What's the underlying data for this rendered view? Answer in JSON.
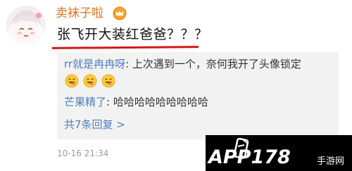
{
  "comment": {
    "username": "卖袜子啦",
    "text": "张飞开大装红爸爸？？？",
    "timestamp": "10-16 21:34"
  },
  "replies": [
    {
      "user": "rr就是冉冉呀",
      "separator": ": ",
      "text": "上次遇到一个，奈何我开了头像锁定",
      "emoji_count": 3
    },
    {
      "user": "芒果精了",
      "separator": ": ",
      "text": "哈哈哈哈哈哈哈哈哈"
    }
  ],
  "more_replies_label": "共7条回复 >",
  "icons": {
    "vip": "crown-badge-icon",
    "emoji": "grinning-tongue-emoji-icon"
  },
  "watermark": {
    "logo_text": "APP178",
    "sub_text": "手游网"
  },
  "colors": {
    "username": "#e2701f",
    "reply_user": "#4f7ec0",
    "underline": "#d7141a",
    "reply_bg": "#f2f2f2"
  }
}
